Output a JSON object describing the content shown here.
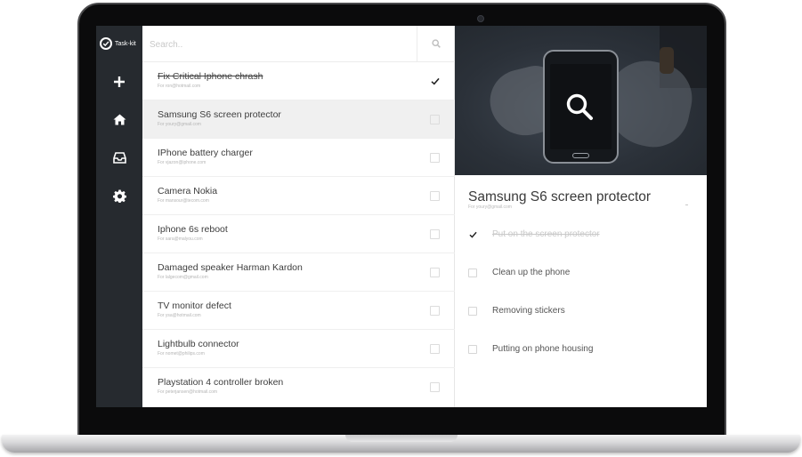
{
  "app": {
    "name": "Task-kit"
  },
  "sidebar": {
    "items": [
      {
        "icon": "plus-icon",
        "label": ""
      },
      {
        "icon": "home-icon",
        "label": ""
      },
      {
        "icon": "inbox-icon",
        "label": ""
      },
      {
        "icon": "gear-icon",
        "label": ""
      }
    ]
  },
  "search": {
    "placeholder": "Search..",
    "value": ""
  },
  "tasks": [
    {
      "title": "Fix Critical Iphone chrash",
      "sub": "For ron@hotmail.com",
      "done": true,
      "selected": false
    },
    {
      "title": "Samsung S6 screen protector",
      "sub": "For youry@gmail.com",
      "done": false,
      "selected": true
    },
    {
      "title": "IPhone battery charger",
      "sub": "For vjazon@iphone.com",
      "done": false,
      "selected": false
    },
    {
      "title": "Camera Nokia",
      "sub": "For mansour@tecom.com",
      "done": false,
      "selected": false
    },
    {
      "title": "Iphone 6s reboot",
      "sub": "For sara@malyou.com",
      "done": false,
      "selected": false
    },
    {
      "title": "Damaged speaker Harman Kardon",
      "sub": "For lalgecom@gmail.com",
      "done": false,
      "selected": false
    },
    {
      "title": "TV monitor defect",
      "sub": "For ysa@hotmail.com",
      "done": false,
      "selected": false
    },
    {
      "title": "Lightbulb connector",
      "sub": "For nomet@philips.com",
      "done": false,
      "selected": false
    },
    {
      "title": "Playstation 4 controller broken",
      "sub": "For peterjansen@hotmail.com",
      "done": false,
      "selected": false
    }
  ],
  "detail": {
    "title": "Samsung S6 screen protector",
    "sub": "For youry@gmail.com",
    "subtasks": [
      {
        "label": "Put on the screen protector",
        "done": true
      },
      {
        "label": "Clean up the phone",
        "done": false
      },
      {
        "label": "Removing stickers",
        "done": false
      },
      {
        "label": "Putting on phone housing",
        "done": false
      }
    ]
  },
  "colors": {
    "sidebar_bg": "#262a2f",
    "selected_row_bg": "#f0f0f0",
    "text_primary": "#3d3d3d",
    "text_muted": "#b5b5b5"
  }
}
